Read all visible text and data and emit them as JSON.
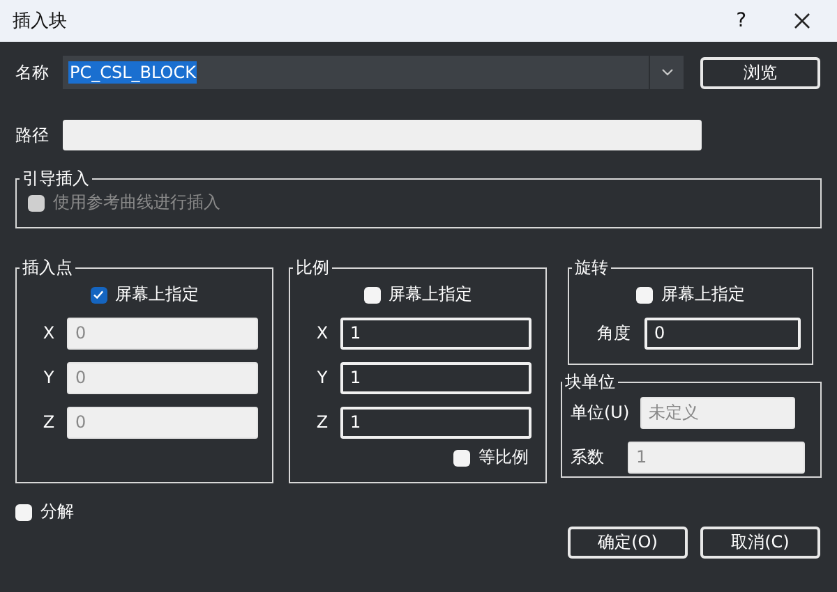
{
  "window": {
    "title": "插入块",
    "help": "?"
  },
  "name": {
    "label": "名称",
    "value": "PC_CSL_BLOCK",
    "selected": true
  },
  "browse_button": "浏览",
  "path": {
    "label": "路径"
  },
  "guide_insert": {
    "title": "引导插入",
    "checkbox": {
      "label": "使用参考曲线进行插入",
      "checked": false,
      "disabled": true
    }
  },
  "insertion_point": {
    "title": "插入点",
    "on_screen": {
      "label": "屏幕上指定",
      "checked": true
    },
    "fields": [
      {
        "label": "X",
        "value": "0",
        "disabled": true
      },
      {
        "label": "Y",
        "value": "0",
        "disabled": true
      },
      {
        "label": "Z",
        "value": "0",
        "disabled": true
      }
    ]
  },
  "scale": {
    "title": "比例",
    "on_screen": {
      "label": "屏幕上指定",
      "checked": false
    },
    "fields": [
      {
        "label": "X",
        "value": "1",
        "disabled": false
      },
      {
        "label": "Y",
        "value": "1",
        "disabled": false
      },
      {
        "label": "Z",
        "value": "1",
        "disabled": false
      }
    ],
    "uniform": {
      "label": "等比例",
      "checked": false
    }
  },
  "rotation": {
    "title": "旋转",
    "on_screen": {
      "label": "屏幕上指定",
      "checked": false
    },
    "fields": [
      {
        "label": "角度",
        "value": "0",
        "disabled": false
      }
    ]
  },
  "block_unit": {
    "title": "块单位",
    "fields": [
      {
        "label": "单位(U)",
        "value": "未定义",
        "disabled": true
      },
      {
        "label": "系数",
        "value": "1",
        "disabled": true
      }
    ]
  },
  "explode": {
    "label": "分解",
    "checked": false
  },
  "buttons": [
    "确定(O)",
    "取消(C)"
  ]
}
